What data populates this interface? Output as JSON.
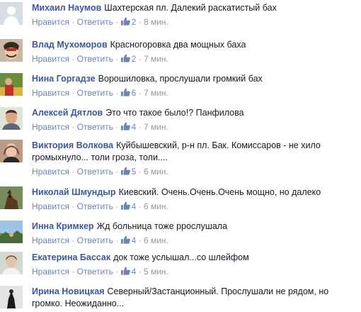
{
  "actions": {
    "like": "Нравится",
    "reply": "Ответить"
  },
  "colors": {
    "name": "#3b5998",
    "link": "#6d84b4",
    "meta": "#9197a3",
    "text": "#141823"
  },
  "icons": {
    "likes": "thumbs-up-icon"
  },
  "comments": [
    {
      "author": "Михаил Наумов",
      "text": "Шахтерская пл. Далекий раскатистый бах",
      "likes": "2",
      "time": "8 мин."
    },
    {
      "author": "Влад Мухоморов",
      "text": "Красногоровка два мощных баха",
      "likes": "2",
      "time": "7 мин."
    },
    {
      "author": "Нина Горгадзе",
      "text": "Ворошиловка, прослушали громкий бах",
      "likes": "6",
      "time": "7 мин."
    },
    {
      "author": "Алексей Дятлов",
      "text": "Это что такое было!? Панфилова",
      "likes": "4",
      "time": "7 мин."
    },
    {
      "author": "Виктория Волкова",
      "text": "Куйбышевский, р-н пл. Бак. Комиссаров - не хило громыхнуло... толи гроза, толи....",
      "likes": "5",
      "time": "6 мин."
    },
    {
      "author": "Николай Шмундыр",
      "text": "Киевский. Очень.Очень.Очень мощно, но далеко",
      "likes": "4",
      "time": "6 мин."
    },
    {
      "author": "Инна Кримкер",
      "text": "Жд больница тоже ррослушала",
      "likes": "4",
      "time": "6 мин."
    },
    {
      "author": "Екатерина Бассак",
      "text": "док тоже услышал...со шлейфом",
      "likes": "4",
      "time": "5 мин."
    },
    {
      "author": "Ирина Новицкая",
      "text": "Северный/Застанционный. Прослушали не рядом, но громко. Неожиданно...",
      "likes": "",
      "time": ""
    }
  ]
}
